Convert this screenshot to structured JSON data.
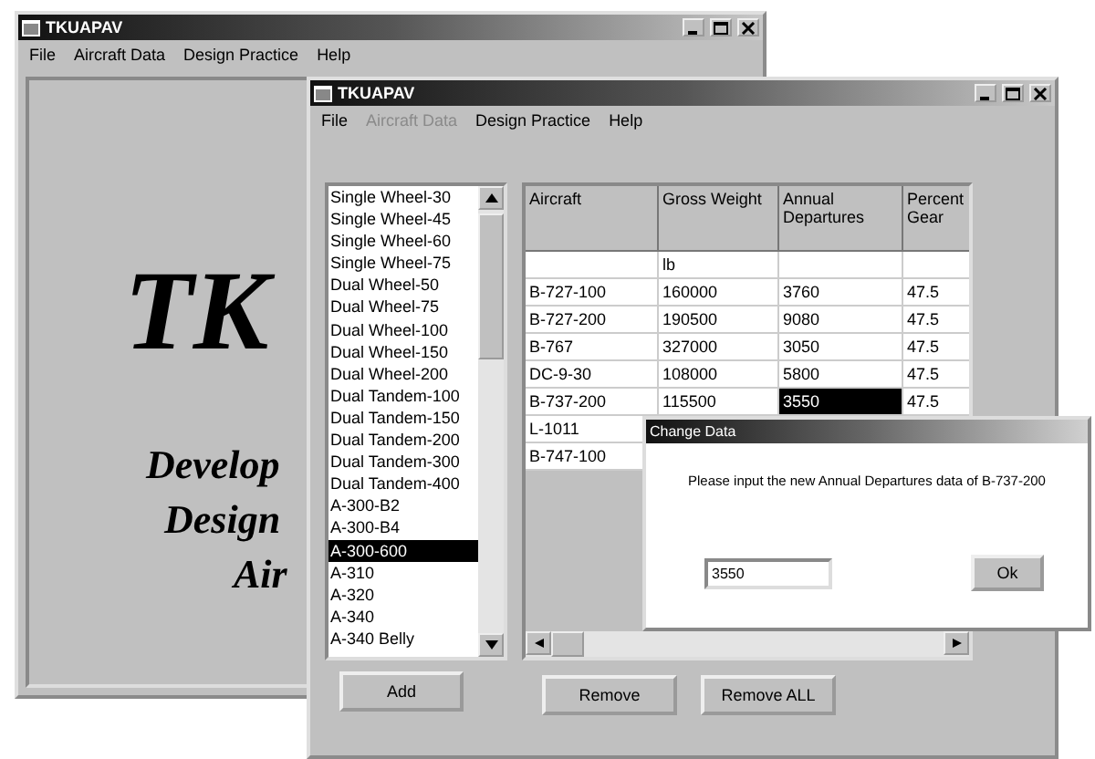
{
  "back_window": {
    "title": "TKUAPAV",
    "menu": [
      {
        "label": "File",
        "disabled": false
      },
      {
        "label": "Aircraft Data",
        "disabled": false
      },
      {
        "label": "Design Practice",
        "disabled": false
      },
      {
        "label": "Help",
        "disabled": false
      }
    ],
    "splash": {
      "heading": "TK",
      "lines": [
        "Develop",
        "Design",
        "Air"
      ]
    }
  },
  "front_window": {
    "title": "TKUAPAV",
    "menu": [
      {
        "label": "File",
        "disabled": false
      },
      {
        "label": "Aircraft Data",
        "disabled": true
      },
      {
        "label": "Design Practice",
        "disabled": false
      },
      {
        "label": "Help",
        "disabled": false
      }
    ],
    "aircraft_list": [
      {
        "label": "Single Wheel-30",
        "selected": false
      },
      {
        "label": "Single Wheel-45",
        "selected": false
      },
      {
        "label": "Single Wheel-60",
        "selected": false
      },
      {
        "label": "Single Wheel-75",
        "selected": false
      },
      {
        "label": "Dual Wheel-50",
        "selected": false
      },
      {
        "label": "Dual Wheel-75",
        "selected": false
      },
      {
        "label": "Dual Wheel-100",
        "selected": false
      },
      {
        "label": "Dual Wheel-150",
        "selected": false
      },
      {
        "label": "Dual Wheel-200",
        "selected": false
      },
      {
        "label": "Dual Tandem-100",
        "selected": false
      },
      {
        "label": "Dual Tandem-150",
        "selected": false
      },
      {
        "label": "Dual Tandem-200",
        "selected": false
      },
      {
        "label": "Dual Tandem-300",
        "selected": false
      },
      {
        "label": "Dual Tandem-400",
        "selected": false
      },
      {
        "label": "A-300-B2",
        "selected": false
      },
      {
        "label": "A-300-B4",
        "selected": false
      },
      {
        "label": "A-300-600",
        "selected": true
      },
      {
        "label": "A-310",
        "selected": false
      },
      {
        "label": "A-320",
        "selected": false
      },
      {
        "label": "A-340",
        "selected": false
      },
      {
        "label": "A-340 Belly",
        "selected": false
      }
    ],
    "table": {
      "columns": [
        {
          "label": "Aircraft"
        },
        {
          "label": "Gross Weight",
          "unit": "lb"
        },
        {
          "label": "Annual Departures"
        },
        {
          "label": "Percent Gear"
        }
      ],
      "rows": [
        {
          "cells": [
            {
              "text": "B-727-100",
              "selected": false
            },
            {
              "text": "160000",
              "selected": false
            },
            {
              "text": "3760",
              "selected": false
            },
            {
              "text": "47.5",
              "selected": false
            }
          ]
        },
        {
          "cells": [
            {
              "text": "B-727-200",
              "selected": false
            },
            {
              "text": "190500",
              "selected": false
            },
            {
              "text": "9080",
              "selected": false
            },
            {
              "text": "47.5",
              "selected": false
            }
          ]
        },
        {
          "cells": [
            {
              "text": "B-767",
              "selected": false
            },
            {
              "text": "327000",
              "selected": false
            },
            {
              "text": "3050",
              "selected": false
            },
            {
              "text": "47.5",
              "selected": false
            }
          ]
        },
        {
          "cells": [
            {
              "text": "DC-9-30",
              "selected": false
            },
            {
              "text": "108000",
              "selected": false
            },
            {
              "text": "5800",
              "selected": false
            },
            {
              "text": "47.5",
              "selected": false
            }
          ]
        },
        {
          "cells": [
            {
              "text": "B-737-200",
              "selected": false
            },
            {
              "text": "115500",
              "selected": false
            },
            {
              "text": "3550",
              "selected": true
            },
            {
              "text": "47.5",
              "selected": false
            }
          ]
        },
        {
          "cells": [
            {
              "text": "L-1011",
              "selected": false
            }
          ]
        },
        {
          "cells": [
            {
              "text": "B-747-100",
              "selected": false
            }
          ]
        }
      ]
    },
    "buttons": [
      "Add",
      "Remove",
      "Remove ALL"
    ]
  },
  "dialog": {
    "title": "Change Data",
    "message": "Please input the new Annual Departures data of B-737-200",
    "value": "3550",
    "button": "Ok"
  }
}
